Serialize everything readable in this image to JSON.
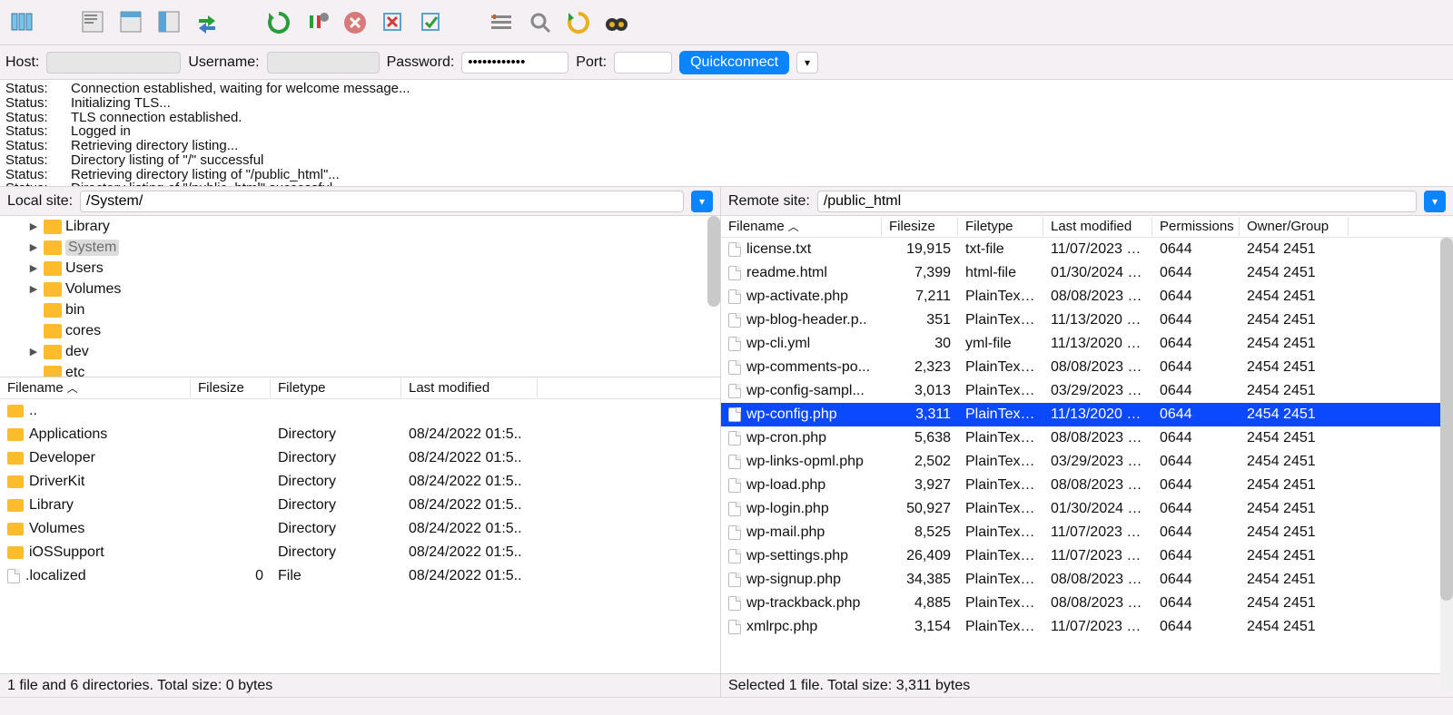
{
  "connection": {
    "host_label": "Host:",
    "user_label": "Username:",
    "pass_label": "Password:",
    "port_label": "Port:",
    "pass_value": "••••••••••••",
    "quickconnect": "Quickconnect"
  },
  "log": [
    {
      "label": "Status:",
      "msg": "Connection established, waiting for welcome message..."
    },
    {
      "label": "Status:",
      "msg": "Initializing TLS..."
    },
    {
      "label": "Status:",
      "msg": "TLS connection established."
    },
    {
      "label": "Status:",
      "msg": "Logged in"
    },
    {
      "label": "Status:",
      "msg": "Retrieving directory listing..."
    },
    {
      "label": "Status:",
      "msg": "Directory listing of \"/\" successful"
    },
    {
      "label": "Status:",
      "msg": "Retrieving directory listing of \"/public_html\"..."
    },
    {
      "label": "Status:",
      "msg": "Directory listing of \"/public_html\" successful"
    }
  ],
  "local": {
    "path_label": "Local site:",
    "path_value": "/System/",
    "tree": [
      {
        "name": "Library",
        "disc": "▶",
        "sel": false,
        "indent": 1
      },
      {
        "name": "System",
        "disc": "▶",
        "sel": true,
        "indent": 1
      },
      {
        "name": "Users",
        "disc": "▶",
        "sel": false,
        "indent": 1
      },
      {
        "name": "Volumes",
        "disc": "▶",
        "sel": false,
        "indent": 1
      },
      {
        "name": "bin",
        "disc": "",
        "sel": false,
        "indent": 1
      },
      {
        "name": "cores",
        "disc": "",
        "sel": false,
        "indent": 1
      },
      {
        "name": "dev",
        "disc": "▶",
        "sel": false,
        "indent": 1
      },
      {
        "name": "etc",
        "disc": "",
        "sel": false,
        "indent": 1
      }
    ],
    "cols": {
      "name": "Filename",
      "size": "Filesize",
      "type": "Filetype",
      "mod": "Last modified"
    },
    "files": [
      {
        "name": "..",
        "size": "",
        "type": "",
        "mod": "",
        "folder": true
      },
      {
        "name": "Applications",
        "size": "",
        "type": "Directory",
        "mod": "08/24/2022 01:5..",
        "folder": true
      },
      {
        "name": "Developer",
        "size": "",
        "type": "Directory",
        "mod": "08/24/2022 01:5..",
        "folder": true
      },
      {
        "name": "DriverKit",
        "size": "",
        "type": "Directory",
        "mod": "08/24/2022 01:5..",
        "folder": true
      },
      {
        "name": "Library",
        "size": "",
        "type": "Directory",
        "mod": "08/24/2022 01:5..",
        "folder": true
      },
      {
        "name": "Volumes",
        "size": "",
        "type": "Directory",
        "mod": "08/24/2022 01:5..",
        "folder": true
      },
      {
        "name": "iOSSupport",
        "size": "",
        "type": "Directory",
        "mod": "08/24/2022 01:5..",
        "folder": true
      },
      {
        "name": ".localized",
        "size": "0",
        "type": "File",
        "mod": "08/24/2022 01:5..",
        "folder": false
      }
    ],
    "status": "1 file and 6 directories. Total size: 0 bytes"
  },
  "remote": {
    "path_label": "Remote site:",
    "path_value": "/public_html",
    "cols": {
      "name": "Filename",
      "size": "Filesize",
      "type": "Filetype",
      "mod": "Last modified",
      "perm": "Permissions",
      "own": "Owner/Group"
    },
    "files": [
      {
        "name": "license.txt",
        "size": "19,915",
        "type": "txt-file",
        "mod": "11/07/2023 1...",
        "perm": "0644",
        "own": "2454 2451",
        "sel": false
      },
      {
        "name": "readme.html",
        "size": "7,399",
        "type": "html-file",
        "mod": "01/30/2024 1...",
        "perm": "0644",
        "own": "2454 2451",
        "sel": false
      },
      {
        "name": "wp-activate.php",
        "size": "7,211",
        "type": "PlainTextT..",
        "mod": "08/08/2023 1...",
        "perm": "0644",
        "own": "2454 2451",
        "sel": false
      },
      {
        "name": "wp-blog-header.p..",
        "size": "351",
        "type": "PlainTextT..",
        "mod": "11/13/2020 0...",
        "perm": "0644",
        "own": "2454 2451",
        "sel": false
      },
      {
        "name": "wp-cli.yml",
        "size": "30",
        "type": "yml-file",
        "mod": "11/13/2020 0...",
        "perm": "0644",
        "own": "2454 2451",
        "sel": false
      },
      {
        "name": "wp-comments-po...",
        "size": "2,323",
        "type": "PlainTextT..",
        "mod": "08/08/2023 1...",
        "perm": "0644",
        "own": "2454 2451",
        "sel": false
      },
      {
        "name": "wp-config-sampl...",
        "size": "3,013",
        "type": "PlainTextT..",
        "mod": "03/29/2023 1...",
        "perm": "0644",
        "own": "2454 2451",
        "sel": false
      },
      {
        "name": "wp-config.php",
        "size": "3,311",
        "type": "PlainTextT..",
        "mod": "11/13/2020 0...",
        "perm": "0644",
        "own": "2454 2451",
        "sel": true
      },
      {
        "name": "wp-cron.php",
        "size": "5,638",
        "type": "PlainTextT..",
        "mod": "08/08/2023 1...",
        "perm": "0644",
        "own": "2454 2451",
        "sel": false
      },
      {
        "name": "wp-links-opml.php",
        "size": "2,502",
        "type": "PlainTextT..",
        "mod": "03/29/2023 1...",
        "perm": "0644",
        "own": "2454 2451",
        "sel": false
      },
      {
        "name": "wp-load.php",
        "size": "3,927",
        "type": "PlainTextT..",
        "mod": "08/08/2023 1...",
        "perm": "0644",
        "own": "2454 2451",
        "sel": false
      },
      {
        "name": "wp-login.php",
        "size": "50,927",
        "type": "PlainTextT..",
        "mod": "01/30/2024 1...",
        "perm": "0644",
        "own": "2454 2451",
        "sel": false
      },
      {
        "name": "wp-mail.php",
        "size": "8,525",
        "type": "PlainTextT..",
        "mod": "11/07/2023 1...",
        "perm": "0644",
        "own": "2454 2451",
        "sel": false
      },
      {
        "name": "wp-settings.php",
        "size": "26,409",
        "type": "PlainTextT..",
        "mod": "11/07/2023 1...",
        "perm": "0644",
        "own": "2454 2451",
        "sel": false
      },
      {
        "name": "wp-signup.php",
        "size": "34,385",
        "type": "PlainTextT..",
        "mod": "08/08/2023 1...",
        "perm": "0644",
        "own": "2454 2451",
        "sel": false
      },
      {
        "name": "wp-trackback.php",
        "size": "4,885",
        "type": "PlainTextT..",
        "mod": "08/08/2023 1...",
        "perm": "0644",
        "own": "2454 2451",
        "sel": false
      },
      {
        "name": "xmlrpc.php",
        "size": "3,154",
        "type": "PlainTextT..",
        "mod": "11/07/2023 1...",
        "perm": "0644",
        "own": "2454 2451",
        "sel": false
      }
    ],
    "status": "Selected 1 file. Total size: 3,311 bytes"
  }
}
